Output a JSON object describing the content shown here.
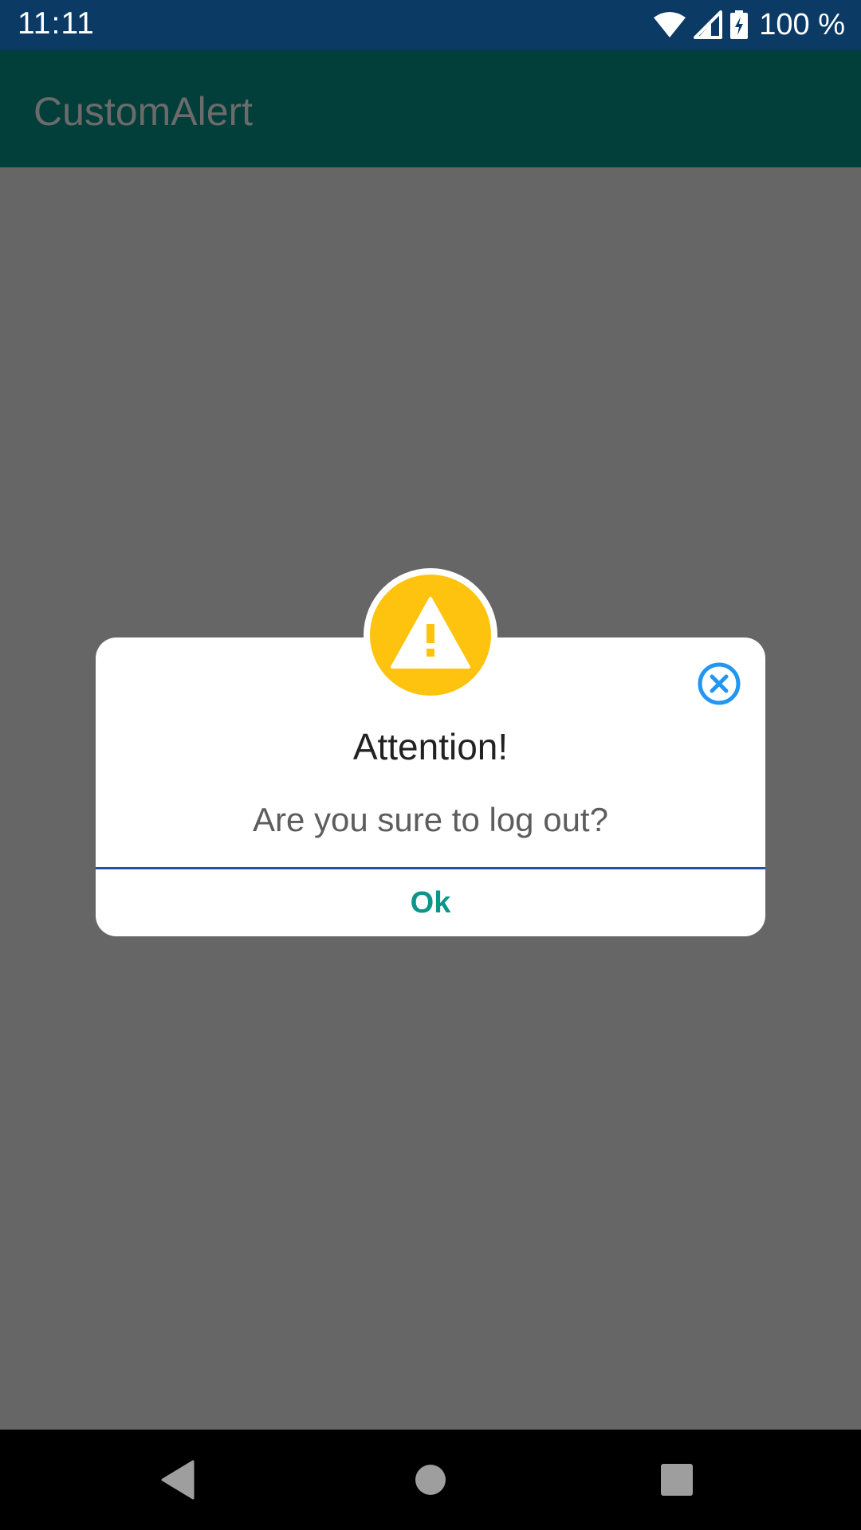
{
  "status_bar": {
    "time": "11:11",
    "battery_text": "100 %",
    "icons": [
      "wifi-icon",
      "cell-signal-icon",
      "battery-charging-icon"
    ]
  },
  "app_bar": {
    "title": "CustomAlert"
  },
  "dialog": {
    "badge_icon": "warning-icon",
    "close_icon": "close-circle-icon",
    "title": "Attention!",
    "message": "Are you sure to log out?",
    "ok_label": "Ok"
  },
  "nav_bar": {
    "icons": [
      "back-icon",
      "home-icon",
      "recents-icon"
    ]
  },
  "colors": {
    "status_bar": "#0b3a64",
    "app_bar": "#023e3a",
    "scrim": "#666666",
    "warning": "#fec30e",
    "close_accent": "#2196f3",
    "divider": "#2a4ea6",
    "ok_text": "#0a9688"
  }
}
